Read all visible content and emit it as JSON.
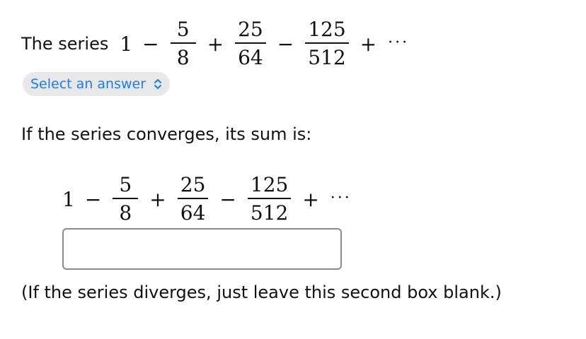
{
  "question": {
    "lead_text": "The series",
    "series": {
      "first_term": "1",
      "ops": [
        "−",
        "+",
        "−",
        "+"
      ],
      "fractions": [
        {
          "numerator": "5",
          "denominator": "8"
        },
        {
          "numerator": "25",
          "denominator": "64"
        },
        {
          "numerator": "125",
          "denominator": "512"
        }
      ],
      "ellipsis": "···"
    }
  },
  "select": {
    "label": "Select an answer",
    "icon": "chevron-up-down-icon"
  },
  "sum_prompt": "If the series converges, its sum is:",
  "answer_input": {
    "value": "",
    "placeholder": ""
  },
  "note": "(If the series diverges, just leave this second box blank.)",
  "colors": {
    "accent": "#1a7ef0",
    "pill_bg": "#e8e8ea",
    "box_border": "#8a8a8a",
    "text": "#111111"
  }
}
